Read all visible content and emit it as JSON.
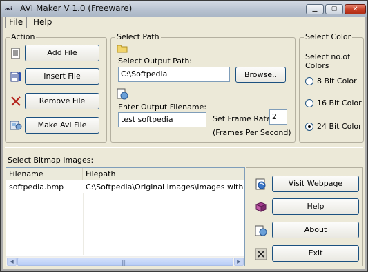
{
  "window": {
    "title": "AVI Maker V 1.0 (Freeware)",
    "app_icon": "avi",
    "min_glyph": "▁",
    "max_glyph": "▢",
    "close_glyph": "✕"
  },
  "menu": {
    "file": "File",
    "help": "Help"
  },
  "action": {
    "title": "Action",
    "add_file": "Add File",
    "insert_file": "Insert File",
    "remove_file": "Remove File",
    "make_avi_file": "Make Avi File"
  },
  "select_path": {
    "title": "Select Path",
    "output_path_label": "Select Output Path:",
    "output_path_value": "C:\\Softpedia",
    "browse_button": "Browse..",
    "filename_label": "Enter Output Filename:",
    "filename_value": "test softpedia",
    "frame_rate_label": "Set Frame Rate:",
    "frame_rate_value": "2",
    "frame_rate_unit": "(Frames Per Second)"
  },
  "select_color": {
    "title": "Select Color",
    "prompt_line1": "Select no.of",
    "prompt_line2": "Colors",
    "options": [
      "8 Bit Color",
      "16 Bit Color",
      "24 Bit Color"
    ],
    "selected": "24 Bit Color"
  },
  "bitmap": {
    "label": "Select Bitmap Images:",
    "columns": [
      "Filename",
      "Filepath"
    ],
    "rows": [
      {
        "filename": "softpedia.bmp",
        "filepath": "C:\\Softpedia\\Original images\\Images with no cr..."
      }
    ]
  },
  "side_buttons": {
    "visit_webpage": "Visit Webpage",
    "help": "Help",
    "about": "About",
    "exit": "Exit"
  },
  "colors": {
    "window_bg": "#ece9d8",
    "button_border": "#1c5180",
    "input_border": "#7f9db9"
  }
}
